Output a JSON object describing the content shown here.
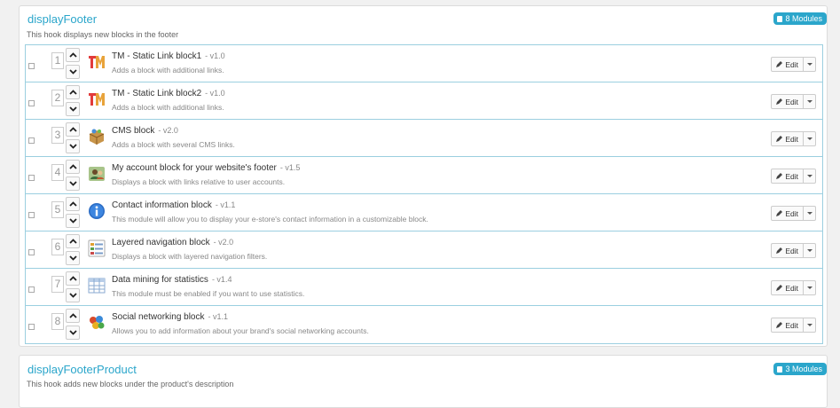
{
  "hooks": [
    {
      "title": "displayFooter",
      "description": "This hook displays new blocks in the footer",
      "badge": "8 Modules",
      "modules": [
        {
          "position": "1",
          "name": "TM - Static Link block1",
          "version": "- v1.0",
          "description": "Adds a block with additional links.",
          "icon": "tm-icon"
        },
        {
          "position": "2",
          "name": "TM - Static Link block2",
          "version": "- v1.0",
          "description": "Adds a block with additional links.",
          "icon": "tm-icon"
        },
        {
          "position": "3",
          "name": "CMS block",
          "version": "- v2.0",
          "description": "Adds a block with several CMS links.",
          "icon": "box-icon"
        },
        {
          "position": "4",
          "name": "My account block for your website's footer",
          "version": "- v1.5",
          "description": "Displays a block with links relative to user accounts.",
          "icon": "users-icon"
        },
        {
          "position": "5",
          "name": "Contact information block",
          "version": "- v1.1",
          "description": "This module will allow you to display your e-store's contact information in a customizable block.",
          "icon": "info-icon"
        },
        {
          "position": "6",
          "name": "Layered navigation block",
          "version": "- v2.0",
          "description": "Displays a block with layered navigation filters.",
          "icon": "list-icon"
        },
        {
          "position": "7",
          "name": "Data mining for statistics",
          "version": "- v1.4",
          "description": "This module must be enabled if you want to use statistics.",
          "icon": "table-icon"
        },
        {
          "position": "8",
          "name": "Social networking block",
          "version": "- v1.1",
          "description": "Allows you to add information about your brand's social networking accounts.",
          "icon": "social-icon"
        }
      ],
      "edit_label": "Edit"
    },
    {
      "title": "displayFooterProduct",
      "description": "This hook adds new blocks under the product's description",
      "badge": "3 Modules"
    }
  ],
  "colors": {
    "accent": "#2ba6cb",
    "row_border": "#9bcfe0"
  }
}
